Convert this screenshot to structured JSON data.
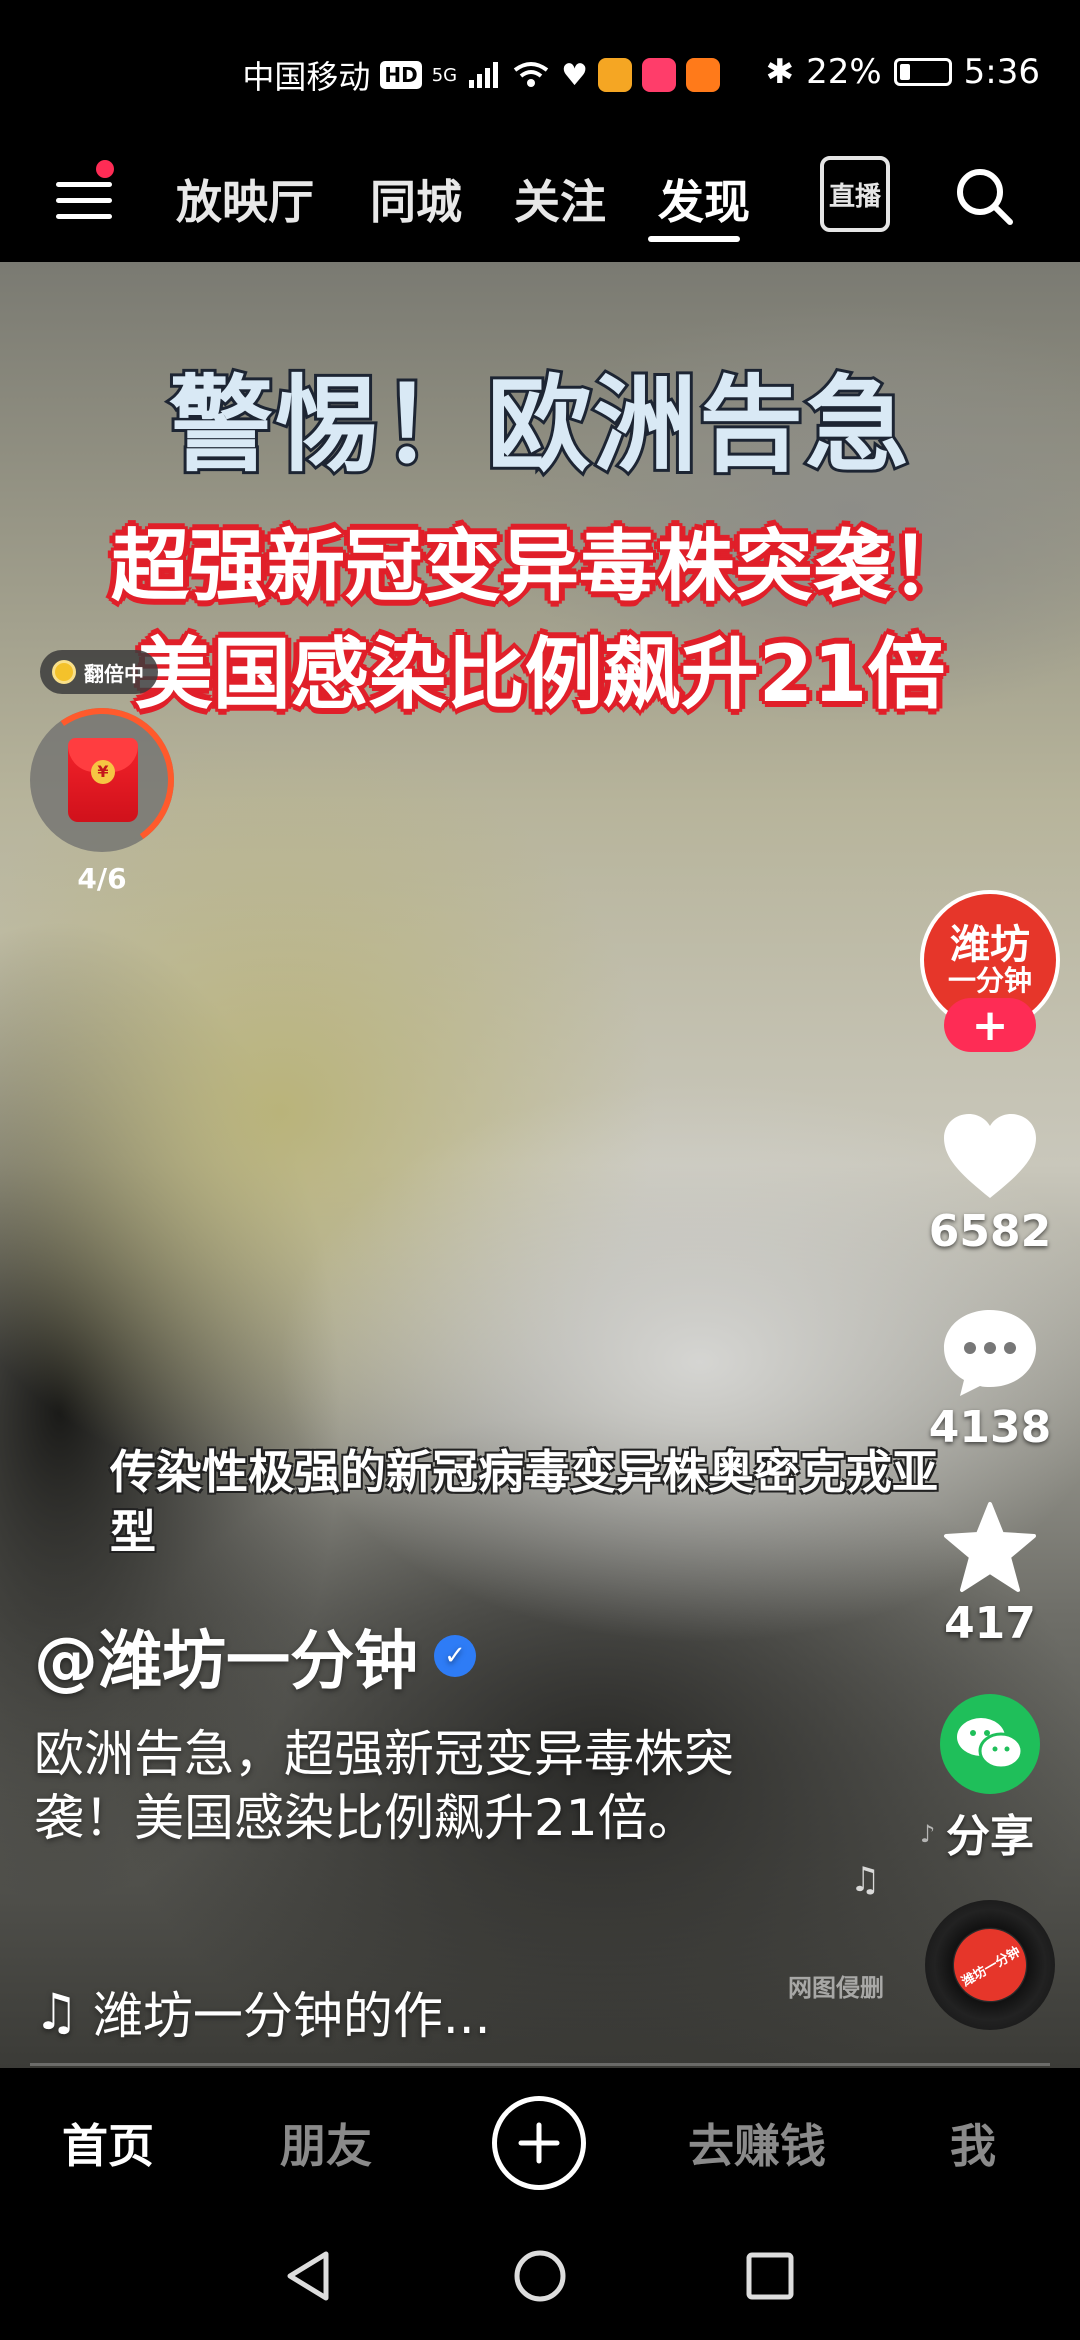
{
  "status_bar": {
    "carrier": "中国移动",
    "hd": "HD",
    "signal": "5G",
    "battery_percent": "22%",
    "battery_level": 0.22,
    "time": "5:36"
  },
  "top_nav": {
    "tabs": [
      {
        "label": "放映厅"
      },
      {
        "label": "同城"
      },
      {
        "label": "关注"
      },
      {
        "label": "发现"
      }
    ],
    "active_tab": "发现",
    "live_label": "直播"
  },
  "video": {
    "headline_1": "警惕！欧洲告急",
    "headline_2": "超强新冠变异毒株突袭！",
    "headline_3": "美国感染比例飙升21倍",
    "subtitle": "传染性极强的新冠病毒变异株奥密克戎亚型",
    "watermark": "网图侵删"
  },
  "red_envelope": {
    "badge": "翻倍中",
    "progress": "4/6",
    "seal": "¥"
  },
  "creator": {
    "avatar_line_1": "潍坊",
    "avatar_line_2": "一分钟",
    "follow_symbol": "+",
    "handle": "@潍坊一分钟",
    "verified": "✓"
  },
  "actions": {
    "likes": "6582",
    "comments": "4138",
    "favorites": "417",
    "share_label": "分享"
  },
  "caption": {
    "description": "欧洲告急，超强新冠变异毒株突袭！美国感染比例飙升21倍。",
    "music": "潍坊一分钟的作..."
  },
  "disc_label": "潍坊一分钟",
  "bottom_nav": {
    "home": "首页",
    "friends": "朋友",
    "earn": "去赚钱",
    "me": "我",
    "active": "首页"
  },
  "colors": {
    "accent": "#fe2c55",
    "verified": "#2e7cf6",
    "share_green": "#1fbf5a",
    "headline_red": "#e0202a"
  },
  "icons": [
    "menu-icon",
    "search-icon",
    "live-icon",
    "heart-icon",
    "comment-icon",
    "star-icon",
    "wechat-icon",
    "music-note-icon",
    "plus-icon",
    "back-icon",
    "home-icon",
    "recents-icon"
  ]
}
